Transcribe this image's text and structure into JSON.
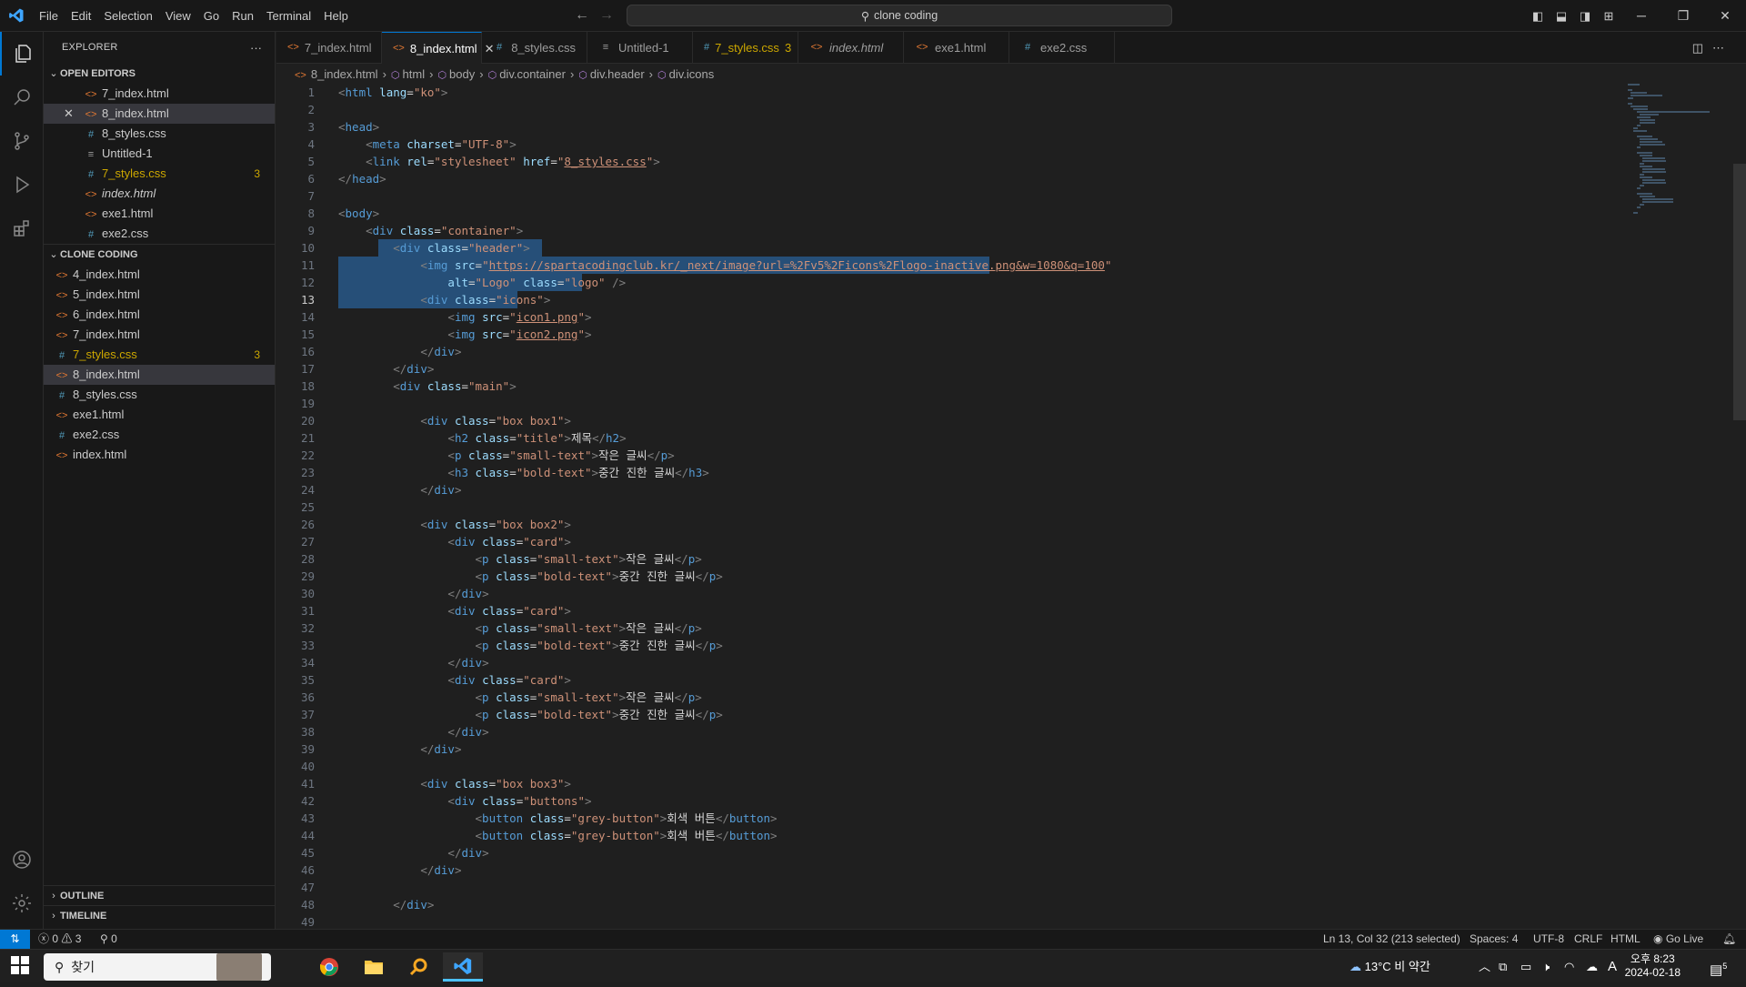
{
  "title_bar": {
    "menu": [
      "File",
      "Edit",
      "Selection",
      "View",
      "Go",
      "Run",
      "Terminal",
      "Help"
    ],
    "search_text": "clone coding"
  },
  "explorer": {
    "title": "EXPLORER",
    "open_editors_label": "OPEN EDITORS",
    "open_editors": [
      {
        "name": "7_index.html",
        "type": "html"
      },
      {
        "name": "8_index.html",
        "type": "html",
        "selected": true
      },
      {
        "name": "8_styles.css",
        "type": "css"
      },
      {
        "name": "Untitled-1",
        "type": "txt"
      },
      {
        "name": "7_styles.css",
        "type": "css",
        "badge": "3"
      },
      {
        "name": "index.html",
        "type": "html"
      },
      {
        "name": "exe1.html",
        "type": "html"
      },
      {
        "name": "exe2.css",
        "type": "css"
      }
    ],
    "folder_label": "CLONE CODING",
    "folder_files": [
      {
        "name": "4_index.html",
        "type": "html"
      },
      {
        "name": "5_index.html",
        "type": "html"
      },
      {
        "name": "6_index.html",
        "type": "html"
      },
      {
        "name": "7_index.html",
        "type": "html"
      },
      {
        "name": "7_styles.css",
        "type": "css",
        "badge": "3"
      },
      {
        "name": "8_index.html",
        "type": "html",
        "selected": true
      },
      {
        "name": "8_styles.css",
        "type": "css"
      },
      {
        "name": "exe1.html",
        "type": "html"
      },
      {
        "name": "exe2.css",
        "type": "css"
      },
      {
        "name": "index.html",
        "type": "html"
      }
    ],
    "outline_label": "OUTLINE",
    "timeline_label": "TIMELINE"
  },
  "tabs": [
    {
      "name": "7_index.html",
      "type": "html"
    },
    {
      "name": "8_index.html",
      "type": "html",
      "active": true
    },
    {
      "name": "8_styles.css",
      "type": "css"
    },
    {
      "name": "Untitled-1",
      "type": "txt"
    },
    {
      "name": "7_styles.css",
      "type": "css",
      "badge": "3"
    },
    {
      "name": "index.html",
      "type": "html",
      "italic": true
    },
    {
      "name": "exe1.html",
      "type": "html"
    },
    {
      "name": "exe2.css",
      "type": "css"
    }
  ],
  "breadcrumb": [
    "8_index.html",
    "html",
    "body",
    "div.container",
    "div.header",
    "div.icons"
  ],
  "editor": {
    "current_line": 13,
    "lines": [
      "<html lang=\"ko\">",
      "",
      "<head>",
      "    <meta charset=\"UTF-8\">",
      "    <link rel=\"stylesheet\" href=\"8_styles.css\">",
      "</head>",
      "",
      "<body>",
      "    <div class=\"container\">",
      "        <div class=\"header\">",
      "            <img src=\"https://spartacodingclub.kr/_next/image?url=%2Fv5%2Ficons%2Flogo-inactive.png&w=1080&q=100\"",
      "                alt=\"Logo\" class=\"logo\" />",
      "            <div class=\"icons\">",
      "                <img src=\"icon1.png\">",
      "                <img src=\"icon2.png\">",
      "            </div>",
      "        </div>",
      "        <div class=\"main\">",
      "",
      "            <div class=\"box box1\">",
      "                <h2 class=\"title\">제목</h2>",
      "                <p class=\"small-text\">작은 글씨</p>",
      "                <h3 class=\"bold-text\">중간 진한 글씨</h3>",
      "            </div>",
      "",
      "            <div class=\"box box2\">",
      "                <div class=\"card\">",
      "                    <p class=\"small-text\">작은 글씨</p>",
      "                    <p class=\"bold-text\">중간 진한 글씨</p>",
      "                </div>",
      "                <div class=\"card\">",
      "                    <p class=\"small-text\">작은 글씨</p>",
      "                    <p class=\"bold-text\">중간 진한 글씨</p>",
      "                </div>",
      "                <div class=\"card\">",
      "                    <p class=\"small-text\">작은 글씨</p>",
      "                    <p class=\"bold-text\">중간 진한 글씨</p>",
      "                </div>",
      "            </div>",
      "",
      "            <div class=\"box box3\">",
      "                <div class=\"buttons\">",
      "                    <button class=\"grey-button\">회색 버튼</button>",
      "                    <button class=\"grey-button\">회색 버튼</button>",
      "                </div>",
      "            </div>",
      "",
      "        </div>",
      ""
    ]
  },
  "status_bar": {
    "errors": "0",
    "warnings": "3",
    "ports": "0",
    "cursor": "Ln 13, Col 32 (213 selected)",
    "spaces": "Spaces: 4",
    "encoding": "UTF-8",
    "eol": "CRLF",
    "language": "HTML",
    "go_live": "Go Live"
  },
  "taskbar": {
    "search_text": "찾기",
    "weather": "13°C  비 약간",
    "time": "오후 8:23",
    "date": "2024-02-18",
    "ime": "A",
    "notif_count": "5"
  },
  "colors": {
    "accent": "#0078d4",
    "html_icon": "#e37933",
    "css_icon": "#519aba",
    "modified": "#cca700",
    "selection": "#264f78"
  }
}
